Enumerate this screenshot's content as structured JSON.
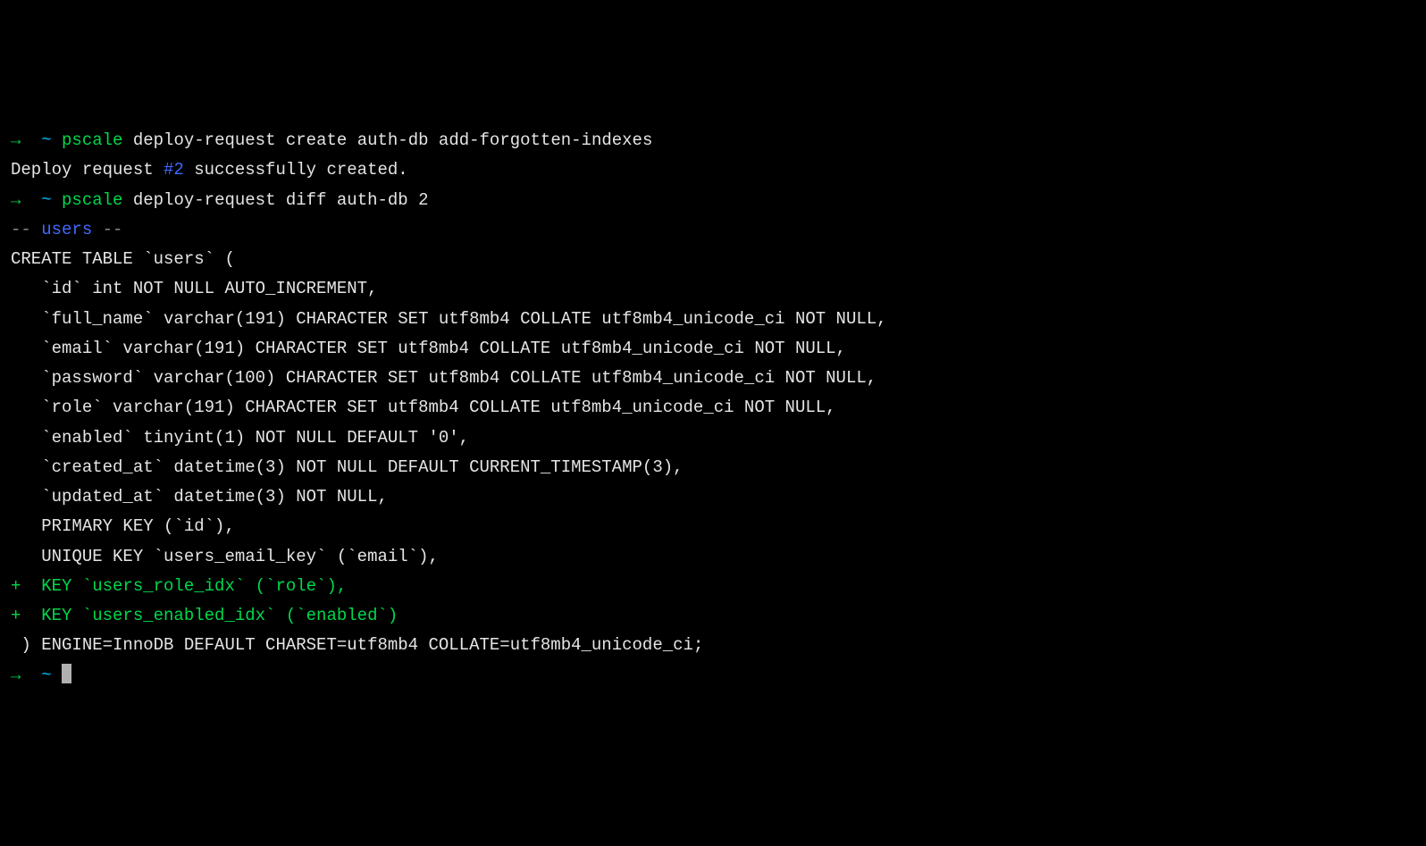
{
  "line1": {
    "arrow": "→",
    "tilde": "~",
    "pscale": "pscale",
    "rest": " deploy-request create auth-db add-forgotten-indexes"
  },
  "line2": {
    "pre": "Deploy request ",
    "num": "#2",
    "post": " successfully created."
  },
  "line3": {
    "arrow": "→",
    "tilde": "~",
    "pscale": "pscale",
    "rest": " deploy-request diff auth-db 2"
  },
  "section": {
    "pre": "-- ",
    "name": "users",
    "post": " --"
  },
  "ddl": {
    "l1": "CREATE TABLE `users` (",
    "l2": "   `id` int NOT NULL AUTO_INCREMENT,",
    "l3": "   `full_name` varchar(191) CHARACTER SET utf8mb4 COLLATE utf8mb4_unicode_ci NOT NULL,",
    "l4": "   `email` varchar(191) CHARACTER SET utf8mb4 COLLATE utf8mb4_unicode_ci NOT NULL,",
    "l5": "   `password` varchar(100) CHARACTER SET utf8mb4 COLLATE utf8mb4_unicode_ci NOT NULL,",
    "l6": "   `role` varchar(191) CHARACTER SET utf8mb4 COLLATE utf8mb4_unicode_ci NOT NULL,",
    "l7": "   `enabled` tinyint(1) NOT NULL DEFAULT '0',",
    "l8": "   `created_at` datetime(3) NOT NULL DEFAULT CURRENT_TIMESTAMP(3),",
    "l9": "   `updated_at` datetime(3) NOT NULL,",
    "l10": "   PRIMARY KEY (`id`),",
    "l11": "   UNIQUE KEY `users_email_key` (`email`),",
    "add1": "+  KEY `users_role_idx` (`role`),",
    "add2": "+  KEY `users_enabled_idx` (`enabled`)",
    "l12": " ) ENGINE=InnoDB DEFAULT CHARSET=utf8mb4 COLLATE=utf8mb4_unicode_ci;"
  },
  "prompt": {
    "arrow": "→",
    "tilde": "~"
  }
}
